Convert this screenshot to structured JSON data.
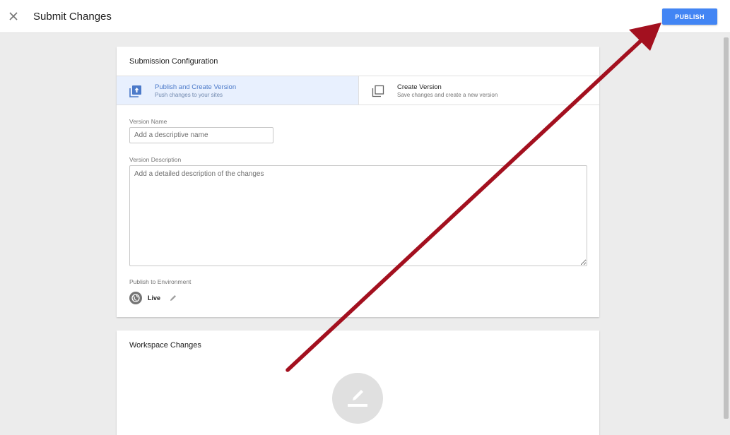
{
  "header": {
    "title": "Submit Changes",
    "publish_label": "PUBLISH",
    "close_icon": "close-icon"
  },
  "submission": {
    "title": "Submission Configuration",
    "options": [
      {
        "label": "Publish and Create Version",
        "sublabel": "Push changes to your sites",
        "icon": "publish-icon",
        "selected": true
      },
      {
        "label": "Create Version",
        "sublabel": "Save changes and create a new version",
        "icon": "copy-icon",
        "selected": false
      }
    ],
    "version_name": {
      "label": "Version Name",
      "placeholder": "Add a descriptive name",
      "value": ""
    },
    "version_description": {
      "label": "Version Description",
      "placeholder": "Add a detailed description of the changes",
      "value": ""
    },
    "environment": {
      "label": "Publish to Environment",
      "name": "Live",
      "icon": "globe-icon"
    }
  },
  "workspace": {
    "title": "Workspace Changes",
    "empty_icon": "edit-icon"
  },
  "colors": {
    "accent": "#4285f4",
    "selected_bg": "#e8f0fe",
    "annotation_arrow": "#a3101f"
  }
}
